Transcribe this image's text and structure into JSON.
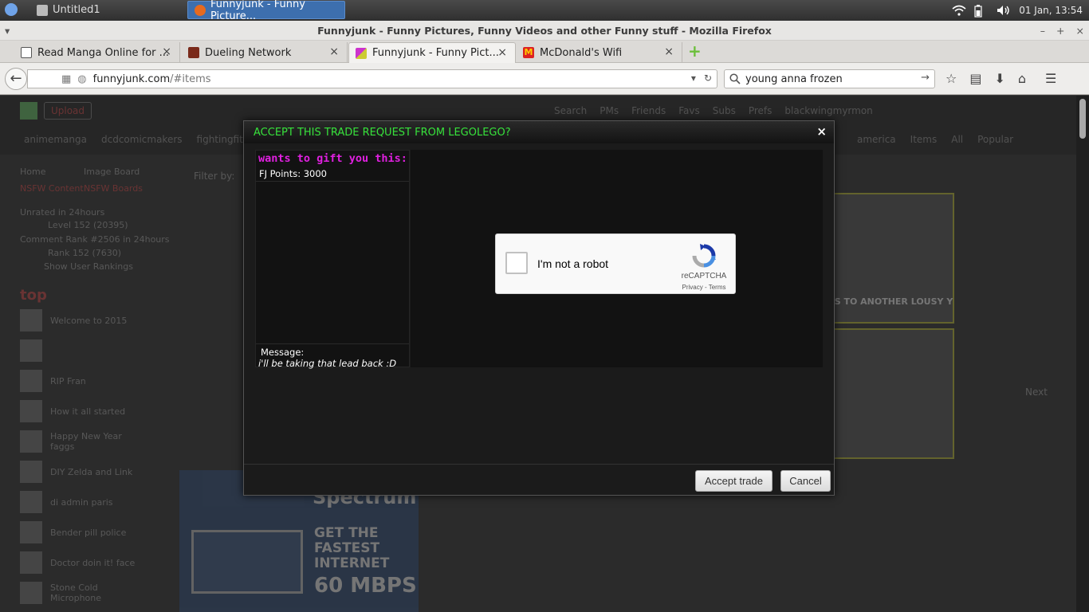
{
  "system_panel": {
    "tasks": [
      {
        "label": "Untitled1"
      },
      {
        "label": "Funnyjunk - Funny Picture..."
      }
    ],
    "clock": "01 Jan, 13:54"
  },
  "window": {
    "title": "Funnyjunk - Funny Pictures, Funny Videos and other Funny stuff - Mozilla Firefox"
  },
  "tabs": [
    {
      "label": "Read Manga Online for ..."
    },
    {
      "label": "Dueling Network"
    },
    {
      "label": "Funnyjunk - Funny Pict..."
    },
    {
      "label": "McDonald's Wifi"
    }
  ],
  "navbar": {
    "url_host": "funnyjunk.com",
    "url_path": "/#items",
    "search_value": "young anna frozen"
  },
  "page": {
    "upload_label": "Upload",
    "user_links": [
      "Search",
      "PMs",
      "Friends",
      "Favs",
      "Subs",
      "Prefs",
      "blackwingmyrmon"
    ],
    "categories_left": [
      "animemanga",
      "dcdcomicmakers",
      "fightingfitness"
    ],
    "categories_right": [
      "america",
      "Items",
      "All",
      "Popular"
    ],
    "left": {
      "home": "Home",
      "image_board": "Image Board",
      "nsfw": "NSFW Content",
      "nsfw_boards": "NSFW Boards",
      "unrated": "Unrated in 24hours",
      "level": "Level 152 (20395)",
      "comment_rank": "Comment Rank #2506 in 24hours",
      "rank": "Rank 152 (7630)",
      "show_ranking": "Show User Rankings",
      "top": "top",
      "items": [
        "Welcome to 2015",
        "",
        "RIP Fran",
        "How it all started",
        "Happy New Year faggs",
        "DIY Zelda and Link",
        "di admin paris",
        "Bender pill police",
        "Doctor doin it! face",
        "Stone Cold Microphone"
      ]
    },
    "filter_label": "Filter by:",
    "thumb_caption": "S TO ANOTHER LOUSY Y",
    "next_label": "Next",
    "ad": {
      "brand": "Spectrum",
      "tagline": "GET THE FASTEST INTERNET",
      "speed": "60 MBPS"
    }
  },
  "modal": {
    "title": "ACCEPT THIS TRADE REQUEST FROM LEGOLEGO?",
    "close_glyph": "×",
    "gift_heading": "wants to gift you this:",
    "gift_item": "FJ Points: 3000",
    "message_label": "Message:",
    "message_text": "i'll be taking that lead back :D",
    "captcha": {
      "label": "I'm not a robot",
      "brand": "reCAPTCHA",
      "links": "Privacy - Terms"
    },
    "accept_label": "Accept trade",
    "cancel_label": "Cancel"
  },
  "colors": {
    "title_green": "#37e23b",
    "gift_magenta": "#e020e0",
    "active_task_blue": "#3d6fae"
  }
}
